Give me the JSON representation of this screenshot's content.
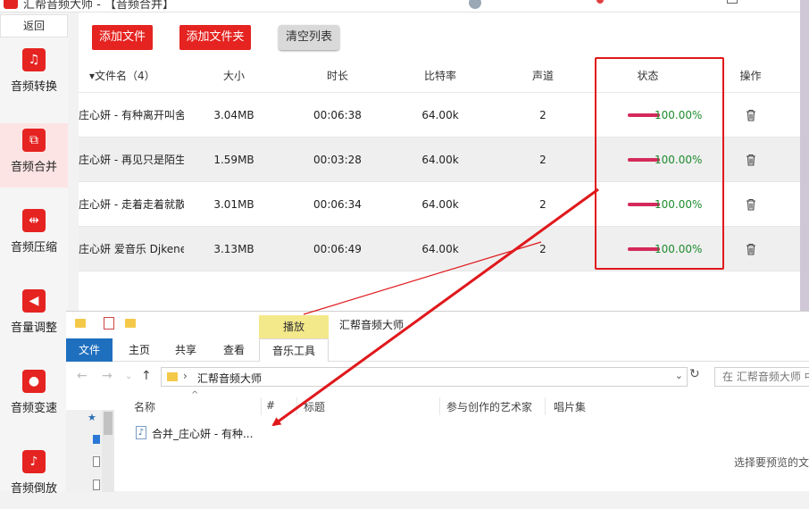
{
  "app": {
    "title": "汇帮音频大师 - 【音频合并】"
  },
  "sidebar": {
    "back_label": "返回",
    "items": [
      {
        "label": "音频转换",
        "icon": "audio-convert-icon",
        "glyph": "♫"
      },
      {
        "label": "音频合并",
        "icon": "audio-merge-icon",
        "glyph": "⧉",
        "active": true
      },
      {
        "label": "音频压缩",
        "icon": "audio-compress-icon",
        "glyph": "⇹"
      },
      {
        "label": "音量调整",
        "icon": "volume-icon",
        "glyph": "◀"
      },
      {
        "label": "音频变速",
        "icon": "microphone-icon",
        "glyph": "●"
      },
      {
        "label": "音频倒放",
        "icon": "music-note-icon",
        "glyph": "♪"
      }
    ]
  },
  "toolbar": {
    "add_file": "添加文件",
    "add_folder": "添加文件夹",
    "clear_list": "清空列表"
  },
  "table": {
    "headers": {
      "name": "▾文件名（4）",
      "size": "大小",
      "duration": "时长",
      "bitrate": "比特率",
      "channels": "声道",
      "status": "状态",
      "action": "操作"
    },
    "rows": [
      {
        "name": "庄心妍 - 有种离开叫舍...",
        "size": "3.04MB",
        "duration": "00:06:38",
        "bitrate": "64.00k",
        "channels": "2",
        "status": "100.00%",
        "progress": 1.0
      },
      {
        "name": "庄心妍 - 再见只是陌生...",
        "size": "1.59MB",
        "duration": "00:03:28",
        "bitrate": "64.00k",
        "channels": "2",
        "status": "100.00%",
        "progress": 1.0
      },
      {
        "name": "庄心妍 - 走着走着就散...",
        "size": "3.01MB",
        "duration": "00:06:34",
        "bitrate": "64.00k",
        "channels": "2",
        "status": "100.00%",
        "progress": 1.0
      },
      {
        "name": "庄心妍 爱音乐 Djkene",
        "size": "3.13MB",
        "duration": "00:06:49",
        "bitrate": "64.00k",
        "channels": "2",
        "status": "100.00%",
        "progress": 1.0
      }
    ]
  },
  "explorer": {
    "ribbon_context_tab": "播放",
    "window_title": "汇帮音频大师",
    "tabs": {
      "file": "文件",
      "home": "主页",
      "share": "共享",
      "view": "查看",
      "music_tools": "音乐工具"
    },
    "address": "汇帮音频大师",
    "search_placeholder": "在 汇帮音频大师 中",
    "columns": {
      "name": "名称",
      "number": "#",
      "title": "标题",
      "artist": "参与创作的艺术家",
      "album": "唱片集"
    },
    "file": {
      "name": "合并_庄心妍 - 有种..."
    },
    "preview_hint": "选择要预览的文件"
  },
  "colors": {
    "accent": "#e52320",
    "progress": "#d42a5b",
    "status_text": "#1e8b2e",
    "highlight": "#e0181b"
  }
}
